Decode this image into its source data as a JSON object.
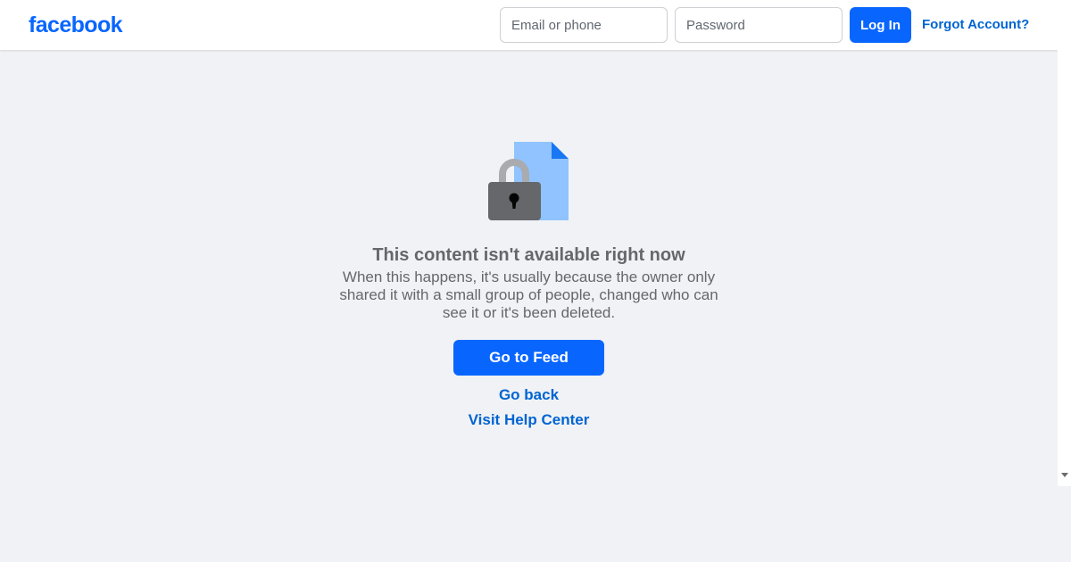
{
  "header": {
    "logo_text": "facebook",
    "email_placeholder": "Email or phone",
    "password_placeholder": "Password",
    "login_label": "Log In",
    "forgot_label": "Forgot Account?"
  },
  "main": {
    "icon": "locked-document-icon",
    "title": "This content isn't available right now",
    "description": "When this happens, it's usually because the owner only shared it with a small group of people, changed who can see it or it's been deleted.",
    "feed_button_label": "Go to Feed",
    "back_link_label": "Go back",
    "help_link_label": "Visit Help Center"
  },
  "colors": {
    "brand": "#0866ff",
    "link": "#0064d1",
    "background": "#f0f2f5",
    "secondary_text": "#65676b",
    "document": "#90c3ff",
    "lock": "#65676b"
  }
}
